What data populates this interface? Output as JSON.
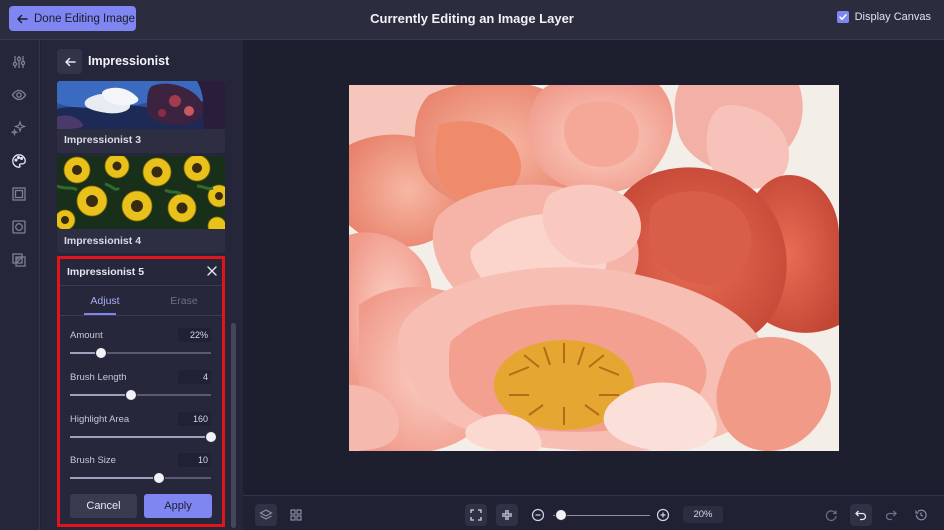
{
  "header": {
    "done_label": "Done Editing Image",
    "title": "Currently Editing an Image Layer",
    "display_canvas_label": "Display Canvas",
    "display_canvas_checked": true
  },
  "rail": {
    "icons": [
      "sliders-icon",
      "eye-icon",
      "sparkle-icon",
      "palette-icon",
      "frame-icon",
      "border-icon",
      "overlay-icon"
    ],
    "active": "palette-icon"
  },
  "panel": {
    "title": "Impressionist",
    "thumbnails": [
      {
        "label": "Impressionist 3"
      },
      {
        "label": "Impressionist 4"
      }
    ]
  },
  "settings": {
    "title": "Impressionist 5",
    "tabs": [
      {
        "label": "Adjust",
        "active": true
      },
      {
        "label": "Erase",
        "active": false
      }
    ],
    "controls": [
      {
        "label": "Amount",
        "value": "22%",
        "level": 0.22
      },
      {
        "label": "Brush Length",
        "value": "4",
        "level": 0.43
      },
      {
        "label": "Highlight Area",
        "value": "160",
        "level": 1.0
      },
      {
        "label": "Brush Size",
        "value": "10",
        "level": 0.63
      }
    ],
    "cancel_label": "Cancel",
    "apply_label": "Apply"
  },
  "bottom": {
    "zoom_value": "20%",
    "zoom_level": 0.02
  },
  "colors": {
    "accent": "#7f86f2",
    "highlight_border": "#e0141a"
  }
}
